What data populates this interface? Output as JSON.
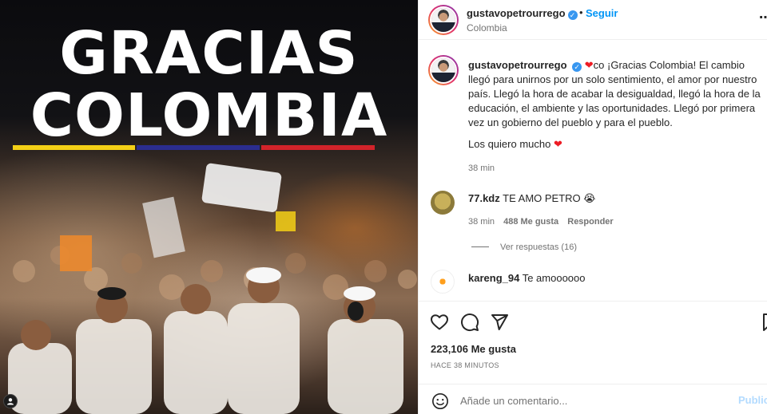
{
  "photo": {
    "title_line1": "GRACIAS",
    "title_line2": "COLOMBIA",
    "flag_colors": [
      "#f4d016",
      "#2b2d8e",
      "#d2232a"
    ]
  },
  "header": {
    "username": "gustavopetrourrego",
    "dot": "•",
    "follow_label": "Seguir",
    "location": "Colombia",
    "more_icon": "more-horizontal-icon"
  },
  "caption": {
    "username": "gustavopetrourrego",
    "text": "co ¡Gracias Colombia! El cambio llegó para unirnos por un solo sentimiento, el amor por nuestro país. Llegó la hora de acabar la desigualdad, llegó la hora de la educación, el ambiente y las oportunidades. Llegó por primera vez un gobierno del pueblo y para el pueblo.",
    "text2": "Los quiero mucho",
    "time": "38 min"
  },
  "comments": [
    {
      "username": "77.kdz",
      "text": "TE AMO PETRO",
      "emoji": "😭",
      "time": "38 min",
      "likes": "488 Me gusta",
      "reply_label": "Responder",
      "view_replies": "Ver respuestas (16)"
    },
    {
      "username": "kareng_94",
      "text": "Te amoooooo"
    }
  ],
  "actions": {
    "likes": "223,106 Me gusta",
    "ago": "HACE 38 MINUTOS",
    "add_comment_placeholder": "Añade un comentario...",
    "publish_label": "Publicar"
  }
}
